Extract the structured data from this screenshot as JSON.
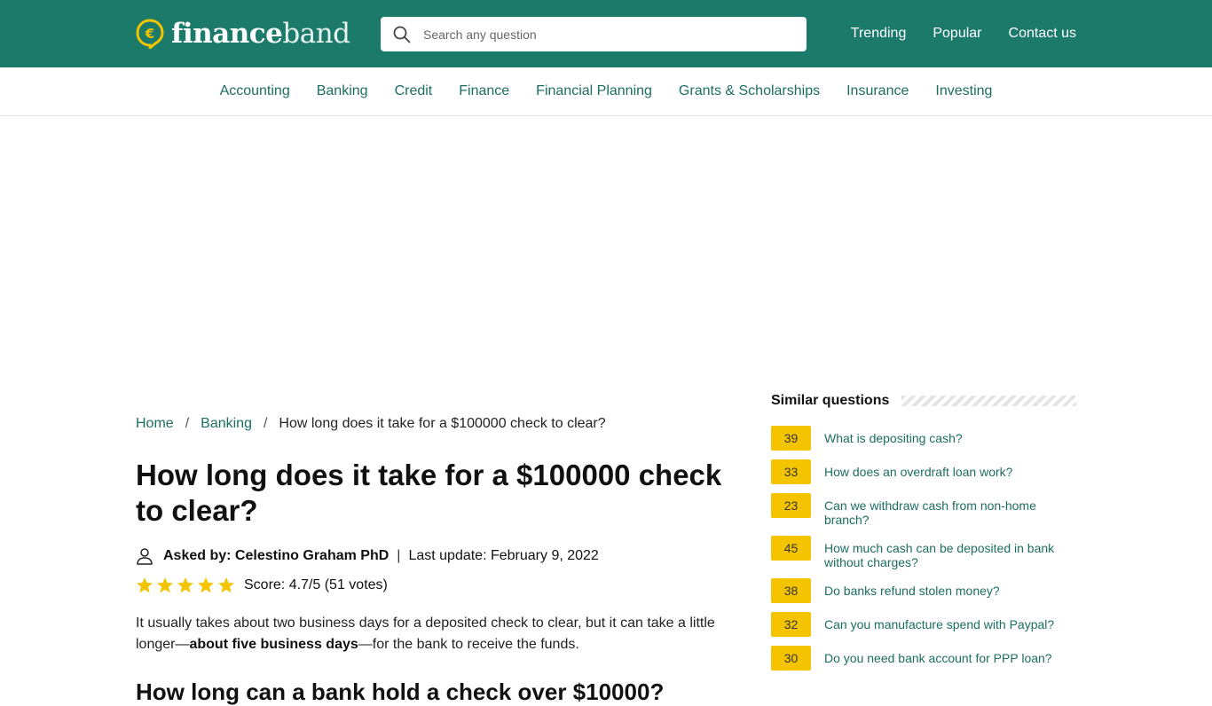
{
  "header": {
    "logo_bold": "finance",
    "logo_light": "band",
    "search_placeholder": "Search any question",
    "nav": [
      "Trending",
      "Popular",
      "Contact us"
    ]
  },
  "categories": [
    "Accounting",
    "Banking",
    "Credit",
    "Finance",
    "Financial Planning",
    "Grants & Scholarships",
    "Insurance",
    "Investing"
  ],
  "breadcrumb": {
    "home": "Home",
    "section": "Banking",
    "current": "How long does it take for a $100000 check to clear?",
    "separator": "/"
  },
  "article": {
    "title": "How long does it take for a $100000 check to clear?",
    "asked_by": "Asked by: Celestino Graham PhD",
    "pipe": "|",
    "last_update": "Last update: February 9, 2022",
    "score": "Score: 4.7/5 (51 votes)",
    "rating": 4.7,
    "answer_pre": "It usually takes about two business days for a deposited check to clear, but it can take a little longer—",
    "answer_bold": "about five business days",
    "answer_post": "—for the bank to receive the funds.",
    "next_heading": "How long can a bank hold a check over $10000?"
  },
  "sidebar": {
    "title": "Similar questions",
    "questions": [
      {
        "count": "39",
        "text": "What is depositing cash?"
      },
      {
        "count": "33",
        "text": "How does an overdraft loan work?"
      },
      {
        "count": "23",
        "text": "Can we withdraw cash from non-home branch?"
      },
      {
        "count": "45",
        "text": "How much cash can be deposited in bank without charges?"
      },
      {
        "count": "38",
        "text": "Do banks refund stolen money?"
      },
      {
        "count": "32",
        "text": "Can you manufacture spend with Paypal?"
      },
      {
        "count": "30",
        "text": "Do you need bank account for PPP loan?"
      }
    ]
  },
  "colors": {
    "brand": "#1c7a6b",
    "link": "#1c6e62",
    "accent": "#f5c400"
  }
}
